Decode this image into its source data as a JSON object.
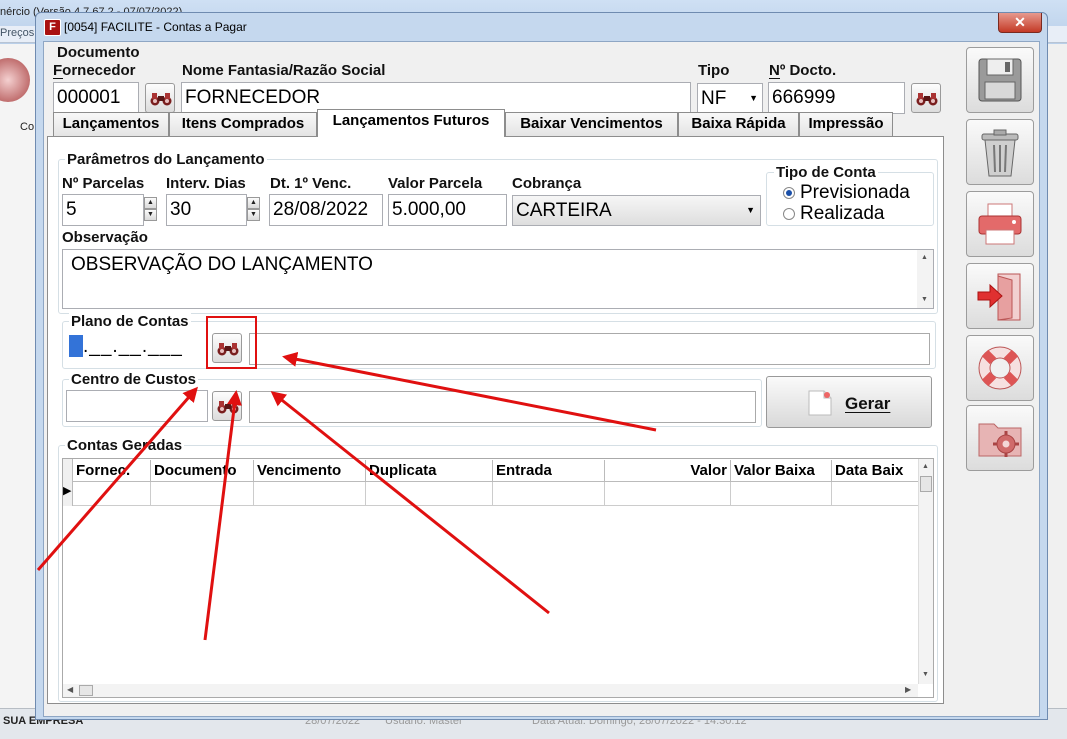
{
  "background": {
    "top_text": "nércio (Versão 4.7.67.2 - 07/07/2022)",
    "menu_text": "Preços",
    "left_text": "Co",
    "status_left": "SUA EMPRESA",
    "status_mid1": "28/07/2022",
    "status_mid2": "Usuário: Master",
    "status_right": "Data Atual: Domingo, 28/07/2022 - 14:30:12"
  },
  "window": {
    "icon_letter": "F",
    "title": "[0054] FACILITE - Contas a Pagar",
    "close_glyph": "✕"
  },
  "header": {
    "documento_label": "Documento",
    "fornecedor_label": "Fornecedor",
    "fornecedor_value": "000001",
    "nome_label": "Nome Fantasia/Razão Social",
    "nome_value": "FORNECEDOR",
    "tipo_label": "Tipo",
    "tipo_value": "NF",
    "ndocto_label": "Nº Docto.",
    "ndocto_value": "666999"
  },
  "tabs": [
    {
      "label": "Lançamentos"
    },
    {
      "label": "Itens Comprados"
    },
    {
      "label": "Lançamentos Futuros"
    },
    {
      "label": "Baixar Vencimentos"
    },
    {
      "label": "Baixa Rápida"
    },
    {
      "label": "Impressão"
    }
  ],
  "params": {
    "group_label": "Parâmetros do Lançamento",
    "parcelas_label": "Nº Parcelas",
    "parcelas_value": "5",
    "intervalo_label": "Interv. Dias",
    "intervalo_value": "30",
    "dt_label": "Dt. 1º Venc.",
    "dt_value": "28/08/2022",
    "valor_label": "Valor Parcela",
    "valor_value": "5.000,00",
    "cobranca_label": "Cobrança",
    "cobranca_value": "CARTEIRA",
    "tipo_conta_label": "Tipo de Conta",
    "opt_previsionada": "Previsionada",
    "opt_realizada": "Realizada",
    "observacao_label": "Observação",
    "observacao_value": "OBSERVAÇÃO DO LANÇAMENTO"
  },
  "plano": {
    "label": "Plano de Contas",
    "mask_value": ".__.__.___"
  },
  "centro": {
    "label": "Centro de Custos"
  },
  "gerar_label": "Gerar",
  "grid": {
    "group_label": "Contas Geradas",
    "columns": [
      "Fornec.",
      "Documento",
      "Vencimento",
      "Duplicata",
      "Entrada",
      "Valor",
      "Valor Baixa",
      "Data Baix"
    ]
  },
  "colors": {
    "annotation": "#e01010",
    "accent": "#1a4fa8"
  }
}
